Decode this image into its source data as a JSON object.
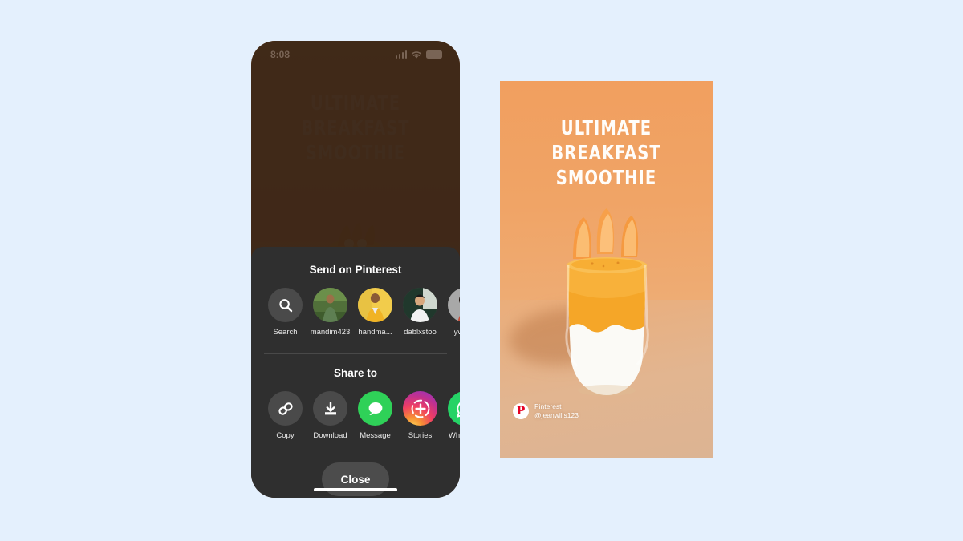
{
  "canvas": {
    "background_color": "#e4f0fd"
  },
  "phone": {
    "status_bar": {
      "time": "8:08",
      "icons": [
        "signal-bars-icon",
        "wifi-icon",
        "battery-icon"
      ]
    },
    "background_pin": {
      "title_lines": [
        "ULTIMATE",
        "BREAKFAST",
        "SMOOTHIE"
      ]
    },
    "share_sheet": {
      "send_section": {
        "title": "Send on Pinterest",
        "items": [
          {
            "label": "Search",
            "type": "action",
            "icon": "search-icon"
          },
          {
            "label": "mandim423",
            "type": "contact",
            "icon": "avatar"
          },
          {
            "label": "handma...",
            "type": "contact",
            "icon": "avatar"
          },
          {
            "label": "dablxstoo",
            "type": "contact",
            "icon": "avatar"
          },
          {
            "label": "yvon...",
            "type": "contact",
            "icon": "avatar"
          }
        ]
      },
      "share_section": {
        "title": "Share to",
        "items": [
          {
            "label": "Copy",
            "icon": "link-icon",
            "color": "#4a4a4a"
          },
          {
            "label": "Download",
            "icon": "download-icon",
            "color": "#4a4a4a"
          },
          {
            "label": "Message",
            "icon": "message-bubble-icon",
            "color": "#2fd158"
          },
          {
            "label": "Stories",
            "icon": "instagram-stories-icon",
            "color": "#c0318f"
          },
          {
            "label": "WhatsA...",
            "icon": "whatsapp-icon",
            "color": "#25d366"
          }
        ]
      },
      "close_label": "Close"
    }
  },
  "pin_card": {
    "title_lines": [
      "ULTIMATE",
      "BREAKFAST",
      "SMOOTHIE"
    ],
    "attribution": {
      "brand": "Pinterest",
      "handle": "@jeanwills123",
      "logo_glyph": "P"
    },
    "background_color": "#f0a263"
  }
}
